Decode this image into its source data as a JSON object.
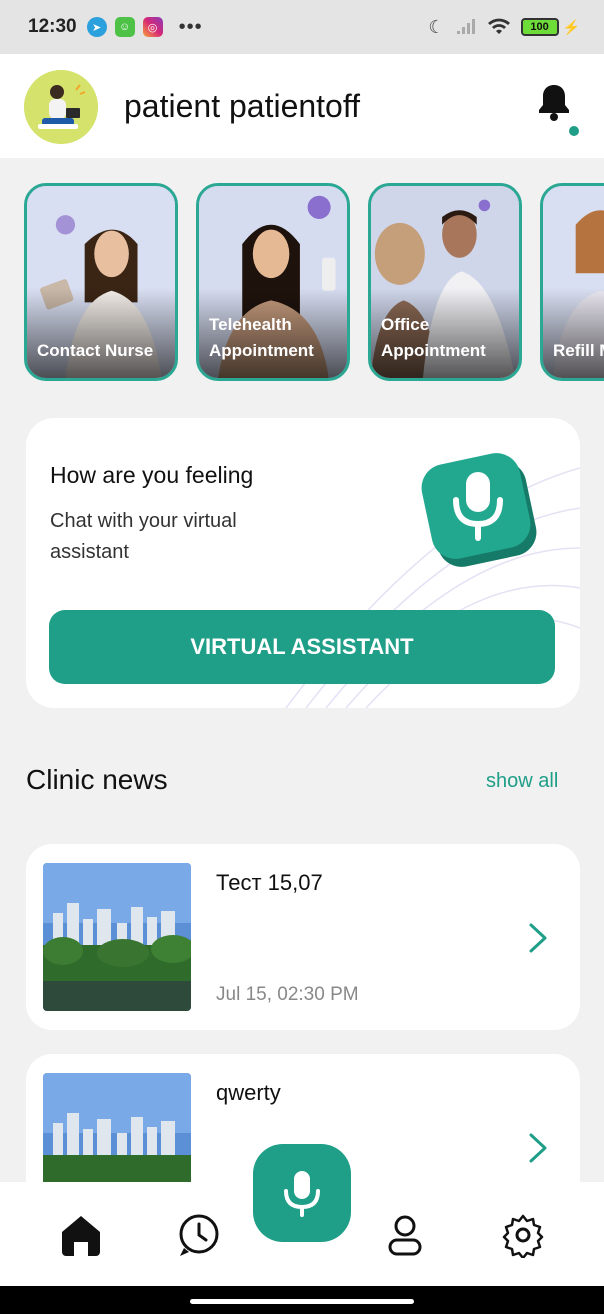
{
  "status_bar": {
    "time": "12:30",
    "battery": "100",
    "icons": [
      "telegram-icon",
      "messenger-icon",
      "instagram-icon",
      "more-dots-icon",
      "moon-icon",
      "signal-icon",
      "wifi-icon",
      "battery-icon",
      "charging-icon"
    ]
  },
  "header": {
    "username": "patient patientoff",
    "notification_icon": "bell-icon"
  },
  "services": [
    {
      "label": "Contact Nurse"
    },
    {
      "label": "Telehealth Appointment"
    },
    {
      "label": "Office Appointment"
    },
    {
      "label": "Refill Medic"
    }
  ],
  "virtual_assistant": {
    "title": "How are you feeling",
    "subtitle": "Chat with your virtual assistant",
    "button_label": "VIRTUAL ASSISTANT"
  },
  "news": {
    "title": "Clinic news",
    "show_all": "show all",
    "items": [
      {
        "headline": "Тест 15,07",
        "date": "Jul 15, 02:30 PM"
      },
      {
        "headline": "qwerty",
        "date": ""
      }
    ]
  },
  "tab_bar": {
    "tabs": [
      "home-icon",
      "history-icon",
      "microphone-icon",
      "profile-icon",
      "settings-icon"
    ]
  },
  "colors": {
    "accent": "#1f9e88",
    "card_border": "#8f72cc",
    "background": "#f1f1f1"
  }
}
